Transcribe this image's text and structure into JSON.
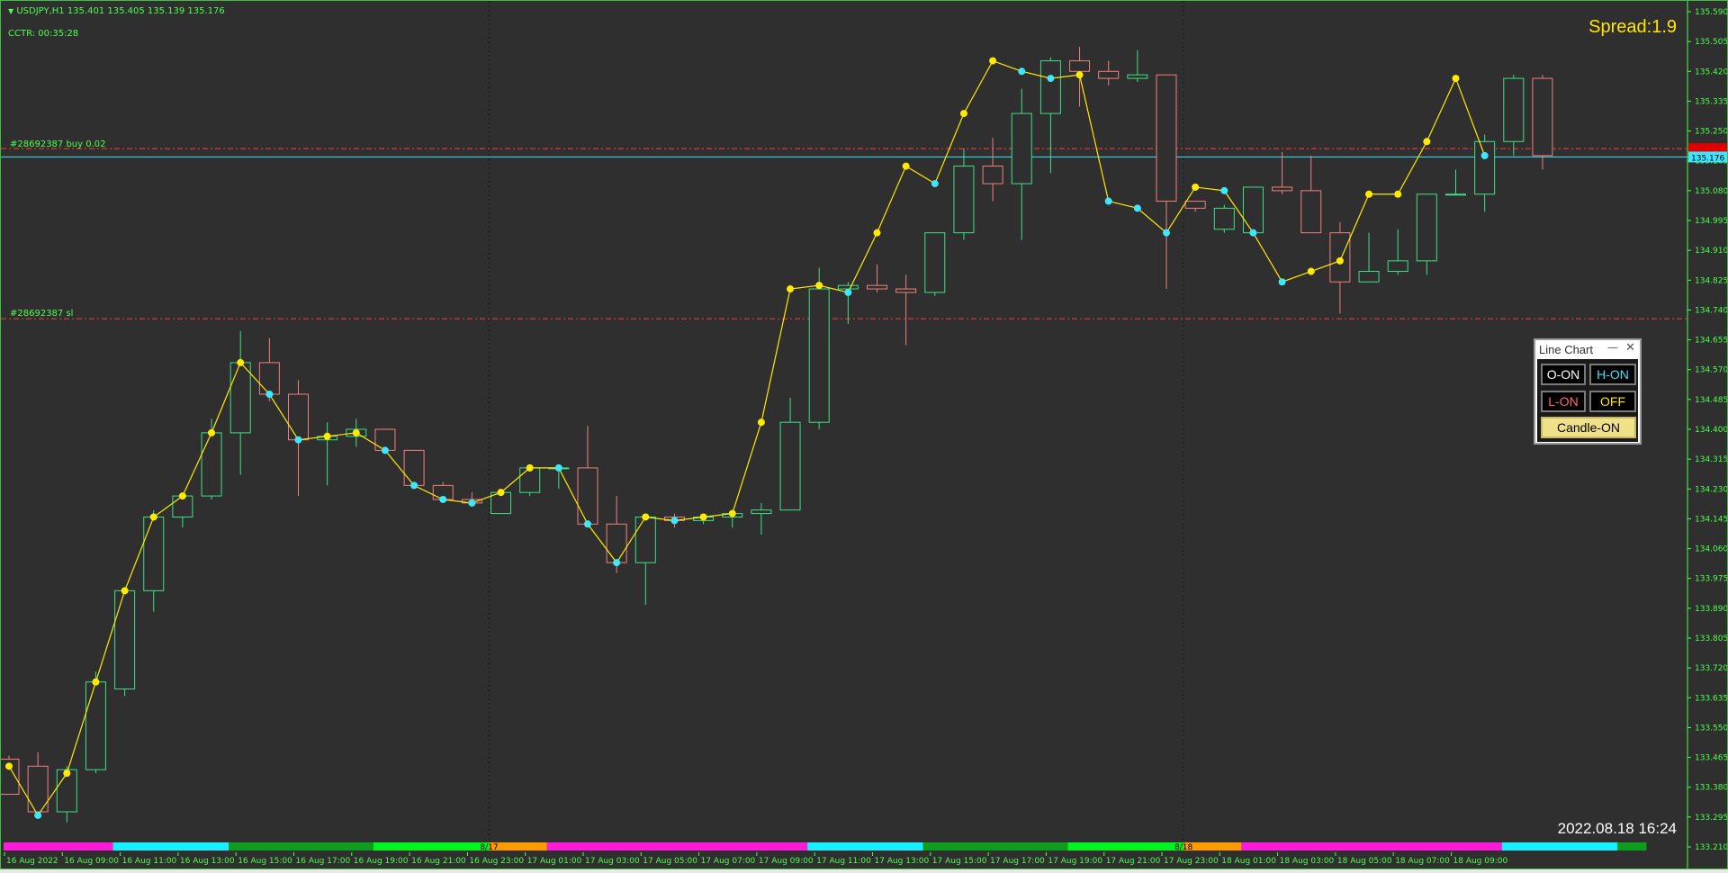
{
  "header": {
    "symbol_line": "USDJPY,H1  135.401 135.405 135.139 135.176",
    "countdown": "CCTR: 00:35:28",
    "spread": "Spread:1.9",
    "datetime": "2022.08.18 16:24"
  },
  "order_labels": {
    "buy": "#28692387 buy 0.02",
    "sl": "#28692387 sl"
  },
  "panel": {
    "title": "Line Chart",
    "minimize": "—",
    "close": "✕",
    "buttons": {
      "o_on": "O-ON",
      "h_on": "H-ON",
      "l_on": "L-ON",
      "off": "OFF",
      "candle_on": "Candle-ON"
    }
  },
  "colors": {
    "background": "#2f2f2f",
    "bull": "#3ee08a",
    "bear": "#f08080",
    "line": "#ffea00",
    "dot_high": "#ffea00",
    "dot_low": "#3ee6ff",
    "order_line": "#ff3b3b",
    "price_line": "#3ee6ff",
    "text": "#4cff4c"
  },
  "chart_data": {
    "type": "candlestick",
    "symbol": "USDJPY",
    "timeframe": "H1",
    "ylim": [
      133.21,
      135.59
    ],
    "y_ticks": [
      "135.590",
      "135.505",
      "135.420",
      "135.335",
      "135.250",
      "135.165",
      "135.080",
      "134.995",
      "134.910",
      "134.825",
      "134.740",
      "134.655",
      "134.570",
      "134.485",
      "134.400",
      "134.315",
      "134.230",
      "134.145",
      "134.060",
      "133.975",
      "133.890",
      "133.805",
      "133.720",
      "133.635",
      "133.550",
      "133.465",
      "133.380",
      "133.295",
      "133.210"
    ],
    "current_price": "135.176",
    "current_price_value": 135.176,
    "buy_level": 135.2,
    "sl_level": 134.715,
    "x_labels": [
      "16 Aug 2022",
      "16 Aug 09:00",
      "16 Aug 11:00",
      "16 Aug 13:00",
      "16 Aug 15:00",
      "16 Aug 17:00",
      "16 Aug 19:00",
      "16 Aug 21:00",
      "16 Aug 23:00",
      "17 Aug 01:00",
      "17 Aug 03:00",
      "17 Aug 05:00",
      "17 Aug 07:00",
      "17 Aug 09:00",
      "17 Aug 11:00",
      "17 Aug 13:00",
      "17 Aug 15:00",
      "17 Aug 17:00",
      "17 Aug 19:00",
      "17 Aug 21:00",
      "17 Aug 23:00",
      "18 Aug 01:00",
      "18 Aug 03:00",
      "18 Aug 05:00",
      "18 Aug 07:00",
      "18 Aug 09:00"
    ],
    "day_separators": [
      {
        "index": 17,
        "label": "8/17"
      },
      {
        "index": 41,
        "label": "8/18"
      }
    ],
    "session_bar": [
      {
        "from": 0,
        "to": 4,
        "color": "#ff19d9"
      },
      {
        "from": 4,
        "to": 8,
        "color": "#19f0ff"
      },
      {
        "from": 8,
        "to": 13,
        "color": "#0e9e1e"
      },
      {
        "from": 13,
        "to": 17,
        "color": "#00f520"
      },
      {
        "from": 17,
        "to": 19,
        "color": "#ff9a00"
      },
      {
        "from": 19,
        "to": 28,
        "color": "#ff19d9"
      },
      {
        "from": 28,
        "to": 32,
        "color": "#19f0ff"
      },
      {
        "from": 32,
        "to": 37,
        "color": "#0e9e1e"
      },
      {
        "from": 37,
        "to": 41,
        "color": "#00f520"
      },
      {
        "from": 41,
        "to": 43,
        "color": "#ff9a00"
      },
      {
        "from": 43,
        "to": 52,
        "color": "#ff19d9"
      },
      {
        "from": 52,
        "to": 56,
        "color": "#19f0ff"
      },
      {
        "from": 56,
        "to": 57,
        "color": "#0e9e1e"
      }
    ],
    "candles": [
      {
        "o": 133.46,
        "h": 133.47,
        "l": 133.36,
        "c": 133.36
      },
      {
        "o": 133.44,
        "h": 133.48,
        "l": 133.3,
        "c": 133.31
      },
      {
        "o": 133.31,
        "h": 133.44,
        "l": 133.28,
        "c": 133.43
      },
      {
        "o": 133.43,
        "h": 133.71,
        "l": 133.42,
        "c": 133.68
      },
      {
        "o": 133.66,
        "h": 133.95,
        "l": 133.64,
        "c": 133.94
      },
      {
        "o": 133.94,
        "h": 134.17,
        "l": 133.88,
        "c": 134.15
      },
      {
        "o": 134.15,
        "h": 134.22,
        "l": 134.12,
        "c": 134.21
      },
      {
        "o": 134.21,
        "h": 134.43,
        "l": 134.2,
        "c": 134.39
      },
      {
        "o": 134.39,
        "h": 134.68,
        "l": 134.27,
        "c": 134.59
      },
      {
        "o": 134.59,
        "h": 134.66,
        "l": 134.48,
        "c": 134.5
      },
      {
        "o": 134.5,
        "h": 134.54,
        "l": 134.21,
        "c": 134.37
      },
      {
        "o": 134.37,
        "h": 134.42,
        "l": 134.24,
        "c": 134.38
      },
      {
        "o": 134.38,
        "h": 134.43,
        "l": 134.35,
        "c": 134.4
      },
      {
        "o": 134.4,
        "h": 134.4,
        "l": 134.34,
        "c": 134.34
      },
      {
        "o": 134.34,
        "h": 134.34,
        "l": 134.25,
        "c": 134.24
      },
      {
        "o": 134.24,
        "h": 134.25,
        "l": 134.2,
        "c": 134.2
      },
      {
        "o": 134.2,
        "h": 134.22,
        "l": 134.18,
        "c": 134.19
      },
      {
        "o": 134.16,
        "h": 134.23,
        "l": 134.16,
        "c": 134.22
      },
      {
        "o": 134.22,
        "h": 134.3,
        "l": 134.21,
        "c": 134.29
      },
      {
        "o": 134.29,
        "h": 134.3,
        "l": 134.23,
        "c": 134.29
      },
      {
        "o": 134.29,
        "h": 134.41,
        "l": 134.13,
        "c": 134.13
      },
      {
        "o": 134.13,
        "h": 134.21,
        "l": 133.99,
        "c": 134.02
      },
      {
        "o": 134.02,
        "h": 134.16,
        "l": 133.9,
        "c": 134.15
      },
      {
        "o": 134.15,
        "h": 134.16,
        "l": 134.12,
        "c": 134.14
      },
      {
        "o": 134.14,
        "h": 134.16,
        "l": 134.13,
        "c": 134.15
      },
      {
        "o": 134.15,
        "h": 134.17,
        "l": 134.12,
        "c": 134.16
      },
      {
        "o": 134.16,
        "h": 134.19,
        "l": 134.1,
        "c": 134.17
      },
      {
        "o": 134.17,
        "h": 134.49,
        "l": 134.17,
        "c": 134.42
      },
      {
        "o": 134.42,
        "h": 134.86,
        "l": 134.4,
        "c": 134.8
      },
      {
        "o": 134.8,
        "h": 134.82,
        "l": 134.7,
        "c": 134.81
      },
      {
        "o": 134.81,
        "h": 134.87,
        "l": 134.79,
        "c": 134.8
      },
      {
        "o": 134.8,
        "h": 134.84,
        "l": 134.64,
        "c": 134.79
      },
      {
        "o": 134.79,
        "h": 134.96,
        "l": 134.78,
        "c": 134.96
      },
      {
        "o": 134.96,
        "h": 135.2,
        "l": 134.94,
        "c": 135.15
      },
      {
        "o": 135.15,
        "h": 135.23,
        "l": 135.05,
        "c": 135.1
      },
      {
        "o": 135.1,
        "h": 135.37,
        "l": 134.94,
        "c": 135.3
      },
      {
        "o": 135.3,
        "h": 135.46,
        "l": 135.13,
        "c": 135.45
      },
      {
        "o": 135.45,
        "h": 135.49,
        "l": 135.32,
        "c": 135.42
      },
      {
        "o": 135.42,
        "h": 135.45,
        "l": 135.38,
        "c": 135.4
      },
      {
        "o": 135.4,
        "h": 135.48,
        "l": 135.39,
        "c": 135.41
      },
      {
        "o": 135.41,
        "h": 135.41,
        "l": 134.8,
        "c": 135.05
      },
      {
        "o": 135.05,
        "h": 135.05,
        "l": 135.02,
        "c": 135.03
      },
      {
        "o": 134.97,
        "h": 135.04,
        "l": 134.96,
        "c": 135.03
      },
      {
        "o": 134.96,
        "h": 135.09,
        "l": 134.95,
        "c": 135.09
      },
      {
        "o": 135.09,
        "h": 135.19,
        "l": 135.07,
        "c": 135.08
      },
      {
        "o": 135.08,
        "h": 135.18,
        "l": 134.96,
        "c": 134.96
      },
      {
        "o": 134.96,
        "h": 134.99,
        "l": 134.73,
        "c": 134.82
      },
      {
        "o": 134.82,
        "h": 134.96,
        "l": 134.82,
        "c": 134.85
      },
      {
        "o": 134.85,
        "h": 134.97,
        "l": 134.84,
        "c": 134.88
      },
      {
        "o": 134.88,
        "h": 135.07,
        "l": 134.84,
        "c": 135.07
      },
      {
        "o": 135.07,
        "h": 135.14,
        "l": 135.07,
        "c": 135.07
      },
      {
        "o": 135.07,
        "h": 135.24,
        "l": 135.02,
        "c": 135.22
      },
      {
        "o": 135.22,
        "h": 135.41,
        "l": 135.18,
        "c": 135.4
      },
      {
        "o": 135.4,
        "h": 135.41,
        "l": 135.14,
        "c": 135.18
      }
    ],
    "line_points": [
      {
        "v": 133.44,
        "t": "h"
      },
      {
        "v": 133.3,
        "t": "l"
      },
      {
        "v": 133.42,
        "t": "h"
      },
      {
        "v": 133.68,
        "t": "h"
      },
      {
        "v": 133.94,
        "t": "h"
      },
      {
        "v": 134.15,
        "t": "h"
      },
      {
        "v": 134.21,
        "t": "h"
      },
      {
        "v": 134.39,
        "t": "h"
      },
      {
        "v": 134.59,
        "t": "h"
      },
      {
        "v": 134.5,
        "t": "l"
      },
      {
        "v": 134.37,
        "t": "l"
      },
      {
        "v": 134.38,
        "t": "h"
      },
      {
        "v": 134.39,
        "t": "h"
      },
      {
        "v": 134.34,
        "t": "l"
      },
      {
        "v": 134.24,
        "t": "l"
      },
      {
        "v": 134.2,
        "t": "l"
      },
      {
        "v": 134.19,
        "t": "l"
      },
      {
        "v": 134.22,
        "t": "h"
      },
      {
        "v": 134.29,
        "t": "h"
      },
      {
        "v": 134.29,
        "t": "l"
      },
      {
        "v": 134.13,
        "t": "l"
      },
      {
        "v": 134.02,
        "t": "l"
      },
      {
        "v": 134.15,
        "t": "h"
      },
      {
        "v": 134.14,
        "t": "l"
      },
      {
        "v": 134.15,
        "t": "h"
      },
      {
        "v": 134.16,
        "t": "h"
      },
      {
        "v": 134.42,
        "t": "h"
      },
      {
        "v": 134.8,
        "t": "h"
      },
      {
        "v": 134.81,
        "t": "h"
      },
      {
        "v": 134.79,
        "t": "l"
      },
      {
        "v": 134.96,
        "t": "h"
      },
      {
        "v": 135.15,
        "t": "h"
      },
      {
        "v": 135.1,
        "t": "l"
      },
      {
        "v": 135.3,
        "t": "h"
      },
      {
        "v": 135.45,
        "t": "h"
      },
      {
        "v": 135.42,
        "t": "l"
      },
      {
        "v": 135.4,
        "t": "l"
      },
      {
        "v": 135.41,
        "t": "h"
      },
      {
        "v": 135.05,
        "t": "l"
      },
      {
        "v": 135.03,
        "t": "l"
      },
      {
        "v": 134.96,
        "t": "l"
      },
      {
        "v": 135.09,
        "t": "h"
      },
      {
        "v": 135.08,
        "t": "l"
      },
      {
        "v": 134.96,
        "t": "l"
      },
      {
        "v": 134.82,
        "t": "l"
      },
      {
        "v": 134.85,
        "t": "h"
      },
      {
        "v": 134.88,
        "t": "h"
      },
      {
        "v": 135.07,
        "t": "h"
      },
      {
        "v": 135.07,
        "t": "h"
      },
      {
        "v": 135.22,
        "t": "h"
      },
      {
        "v": 135.4,
        "t": "h"
      },
      {
        "v": 135.18,
        "t": "l"
      }
    ]
  }
}
